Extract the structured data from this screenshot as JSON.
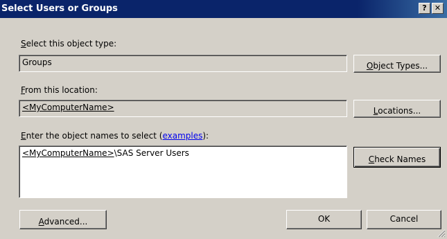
{
  "window": {
    "title": "Select Users or Groups",
    "help_button": "?",
    "close_button": "✕"
  },
  "object_type": {
    "label_accel": "S",
    "label_rest": "elect this object type:",
    "value": "Groups",
    "button_accel": "O",
    "button_rest": "bject Types..."
  },
  "location": {
    "label_accel": "F",
    "label_rest": "rom this location:",
    "value": "<MyComputerName>",
    "button_accel": "L",
    "button_rest": "ocations..."
  },
  "names": {
    "label_accel": "E",
    "label_rest": "nter the object names to select (",
    "link": "examples",
    "label_tail": "):",
    "value_link": "<MyComputerName>",
    "value_rest": "\\SAS Server Users",
    "button_accel": "C",
    "button_rest": "heck Names"
  },
  "footer": {
    "advanced_accel": "A",
    "advanced_rest": "dvanced...",
    "ok": "OK",
    "cancel": "Cancel"
  }
}
